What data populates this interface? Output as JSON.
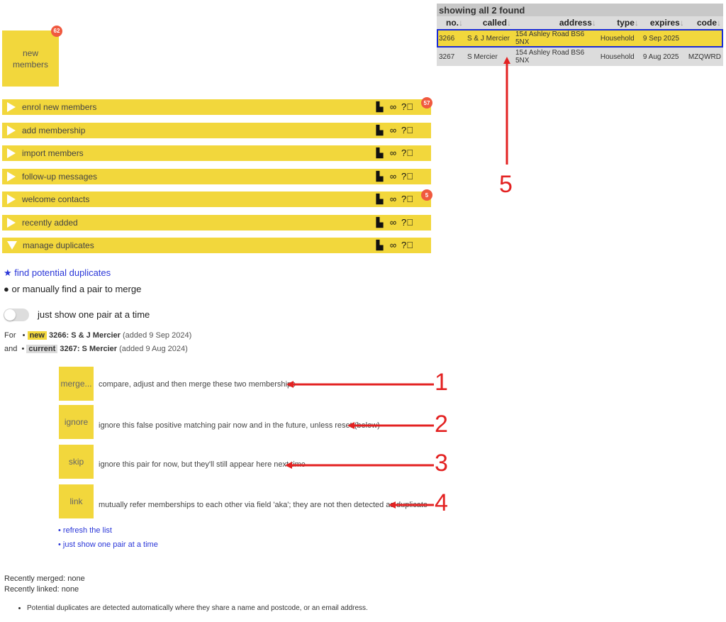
{
  "tile": {
    "label_line1": "new",
    "label_line2": "members",
    "badge": "62"
  },
  "menu": [
    {
      "label": "enrol new members",
      "badge": "57",
      "expanded": false
    },
    {
      "label": "add membership",
      "expanded": false
    },
    {
      "label": "import members",
      "expanded": false
    },
    {
      "label": "follow-up messages",
      "expanded": false
    },
    {
      "label": "welcome contacts",
      "badge": "5",
      "expanded": false
    },
    {
      "label": "recently added",
      "expanded": false
    },
    {
      "label": "manage duplicates",
      "expanded": true
    }
  ],
  "icons": {
    "copy": "copy-icon",
    "link": "link-icon",
    "help": "help-icon"
  },
  "options": {
    "find_link": "find potential duplicates",
    "manual_text": "or manually find a pair to merge",
    "toggle_label": "just show one pair at a time"
  },
  "pair": {
    "for_label": "For",
    "and_label": "and",
    "new_tag": "new",
    "new_desc": "3266: S & J Mercier",
    "new_added": "(added 9 Sep 2024)",
    "current_tag": "current",
    "current_desc": "3267: S Mercier",
    "current_added": "(added 9 Aug 2024)"
  },
  "actions": [
    {
      "label": "merge...",
      "desc": "compare, adjust and then merge these two memberships"
    },
    {
      "label": "ignore",
      "desc": "ignore this false positive matching pair now and in the future, unless reset (below)"
    },
    {
      "label": "skip",
      "desc": "ignore this pair for now, but they'll still appear here next time"
    },
    {
      "label": "link",
      "desc": "mutually refer memberships to each other via field 'aka'; they are not then detected as duplicate"
    }
  ],
  "sublinks": {
    "refresh": "• refresh the list",
    "one_pair": "• just show one pair at a time"
  },
  "recent": {
    "merged": "Recently merged: none",
    "linked": "Recently linked: none"
  },
  "note": "Potential duplicates are detected automatically where they share a name and postcode, or an email address.",
  "table": {
    "caption": "showing all 2 found",
    "headers": [
      "no.",
      "called",
      "address",
      "type",
      "expires",
      "code"
    ],
    "sort_arrow": "↓",
    "rows": [
      [
        "3266",
        "S & J Mercier",
        "154 Ashley Road BS6 5NX",
        "Household",
        "9 Sep 2025",
        ""
      ],
      [
        "3267",
        "S Mercier",
        "154 Ashley Road BS6 5NX",
        "Household",
        "9 Aug 2025",
        "MZQWRD"
      ]
    ]
  },
  "annotations": [
    "1",
    "2",
    "3",
    "4",
    "5"
  ],
  "colors": {
    "accent": "#f2d73c",
    "badge": "#f0593f",
    "link": "#2a36d8",
    "annotation": "#e32222",
    "selected_outline": "#1a2bd6"
  }
}
